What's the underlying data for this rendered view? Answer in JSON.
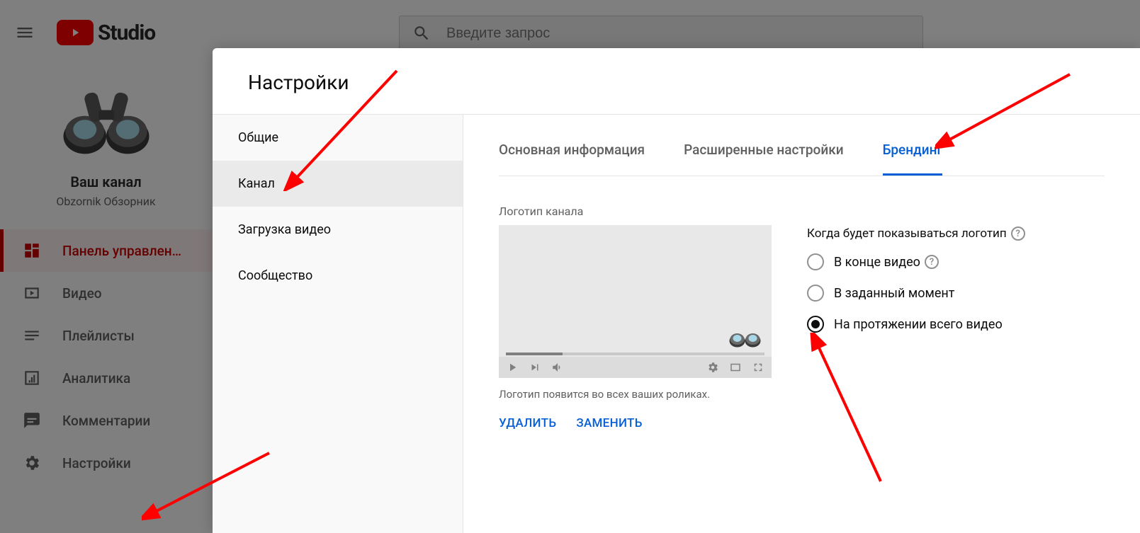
{
  "header": {
    "logo_text": "Studio",
    "search_placeholder": "Введите запрос"
  },
  "channel": {
    "title": "Ваш канал",
    "subtitle": "Obzornik Обзорник"
  },
  "sidebar": {
    "items": [
      {
        "label": "Панель управлен…"
      },
      {
        "label": "Видео"
      },
      {
        "label": "Плейлисты"
      },
      {
        "label": "Аналитика"
      },
      {
        "label": "Комментарии"
      },
      {
        "label": "Настройки"
      }
    ]
  },
  "modal": {
    "title": "Настройки",
    "side": [
      {
        "label": "Общие"
      },
      {
        "label": "Канал"
      },
      {
        "label": "Загрузка видео"
      },
      {
        "label": "Сообщество"
      }
    ],
    "tabs": [
      {
        "label": "Основная информация"
      },
      {
        "label": "Расширенные настройки"
      },
      {
        "label": "Брендинг"
      }
    ],
    "branding": {
      "section_label": "Логотип канала",
      "preview_note": "Логотип появится во всех ваших роликах.",
      "delete_btn": "УДАЛИТЬ",
      "replace_btn": "ЗАМЕНИТЬ",
      "radio_title": "Когда будет показываться логотип",
      "options": [
        {
          "label": "В конце видео",
          "help": true
        },
        {
          "label": "В заданный момент"
        },
        {
          "label": "На протяжении всего видео"
        }
      ],
      "selected_option": 2
    }
  }
}
